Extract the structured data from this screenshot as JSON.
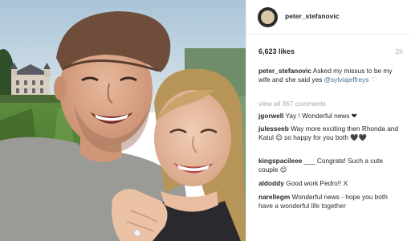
{
  "post": {
    "username": "peter_stefanovic",
    "likes": "6,623 likes",
    "time": "2h",
    "caption": {
      "user": "peter_stefanovic",
      "text": " Asked my missus to be my wife and she said yes ",
      "mention": "@sylviajeffreys",
      "extra": " ♡"
    },
    "view_all": "view all 367 comments"
  },
  "comments": [
    {
      "user": "jgorwell",
      "text": " Yay ! Wonderful news ❤"
    },
    {
      "user": "julesseeb",
      "text": " Way more exciting then Rhonda and Katul 😊 so happy for you both 🖤🖤"
    },
    {
      "user": "kingspacileee",
      "text": " ___ Congrats! Such a cute couple 😊"
    },
    {
      "user": "aldoddy",
      "text": " Good work Pedro!! X"
    },
    {
      "user": "narellegm",
      "text": " Wonderful news - hope you both have a wonderful life together"
    }
  ],
  "colors": {
    "mention": "#3f729b",
    "muted": "#a8a8a8",
    "text": "#262626"
  },
  "icons": {
    "avatar": "profile-avatar"
  }
}
